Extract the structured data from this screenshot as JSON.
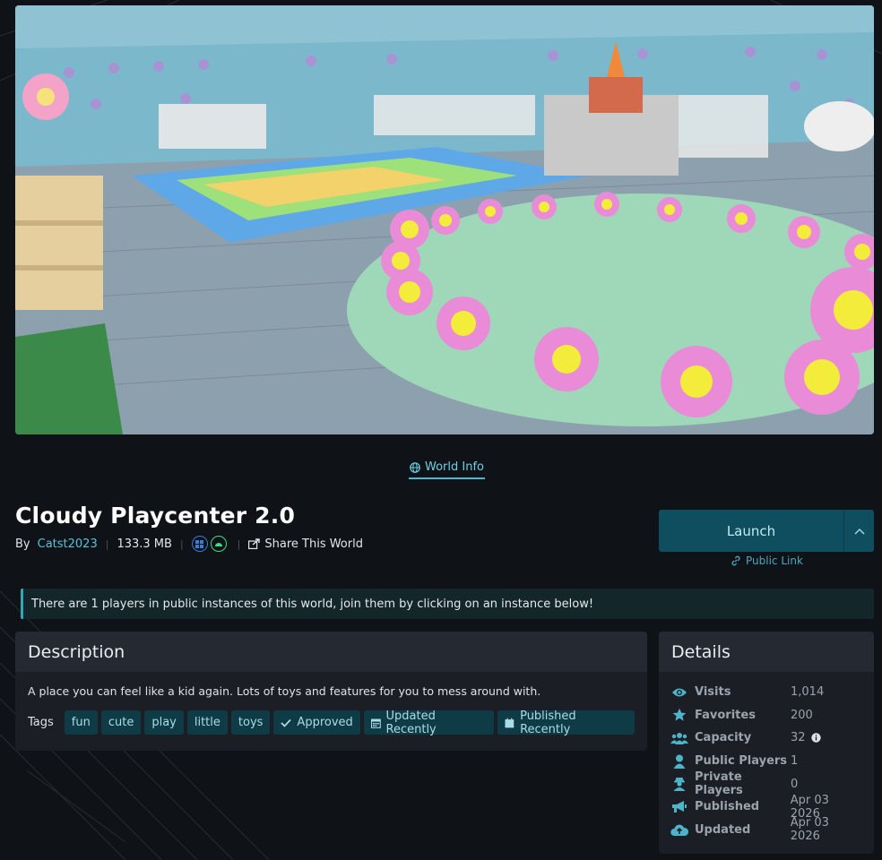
{
  "tab": {
    "label": "World Info"
  },
  "world": {
    "title": "Cloudy Playcenter 2.0",
    "by_label": "By",
    "author": "Catst2023",
    "size": "133.3 MB",
    "platforms": [
      "windows-icon",
      "android-icon"
    ],
    "share_label": "Share This World"
  },
  "launch": {
    "label": "Launch",
    "public_link": "Public Link"
  },
  "notice": {
    "text": "There are 1 players in public instances of this world, join them by clicking on an instance below!"
  },
  "description": {
    "heading": "Description",
    "text": "A place you can feel like a kid again. Lots of toys and features for you to mess around with.",
    "tags_label": "Tags",
    "tags": [
      {
        "label": "fun"
      },
      {
        "label": "cute"
      },
      {
        "label": "play"
      },
      {
        "label": "little"
      },
      {
        "label": "toys"
      },
      {
        "label": "Approved",
        "icon": "check-icon"
      },
      {
        "label": "Updated Recently",
        "icon": "calendar-icon"
      },
      {
        "label": "Published Recently",
        "icon": "calendar-icon"
      }
    ]
  },
  "details": {
    "heading": "Details",
    "rows": [
      {
        "key": "Visits",
        "value": "1,014",
        "icon": "eye-icon"
      },
      {
        "key": "Favorites",
        "value": "200",
        "icon": "star-icon"
      },
      {
        "key": "Capacity",
        "value": "32",
        "icon": "users-icon"
      },
      {
        "key": "Public Players",
        "value": "1",
        "icon": "user-icon"
      },
      {
        "key": "Private Players",
        "value": "0",
        "icon": "user-secret-icon"
      },
      {
        "key": "Published",
        "value": "Apr 03 2026",
        "icon": "megaphone-icon"
      },
      {
        "key": "Updated",
        "value": "Apr 03 2026",
        "icon": "cloud-upload-icon"
      }
    ]
  },
  "colors": {
    "accent": "#49b6cc",
    "background": "#0f1216",
    "card": "#1b1f25",
    "tag": "#0e3b45"
  }
}
